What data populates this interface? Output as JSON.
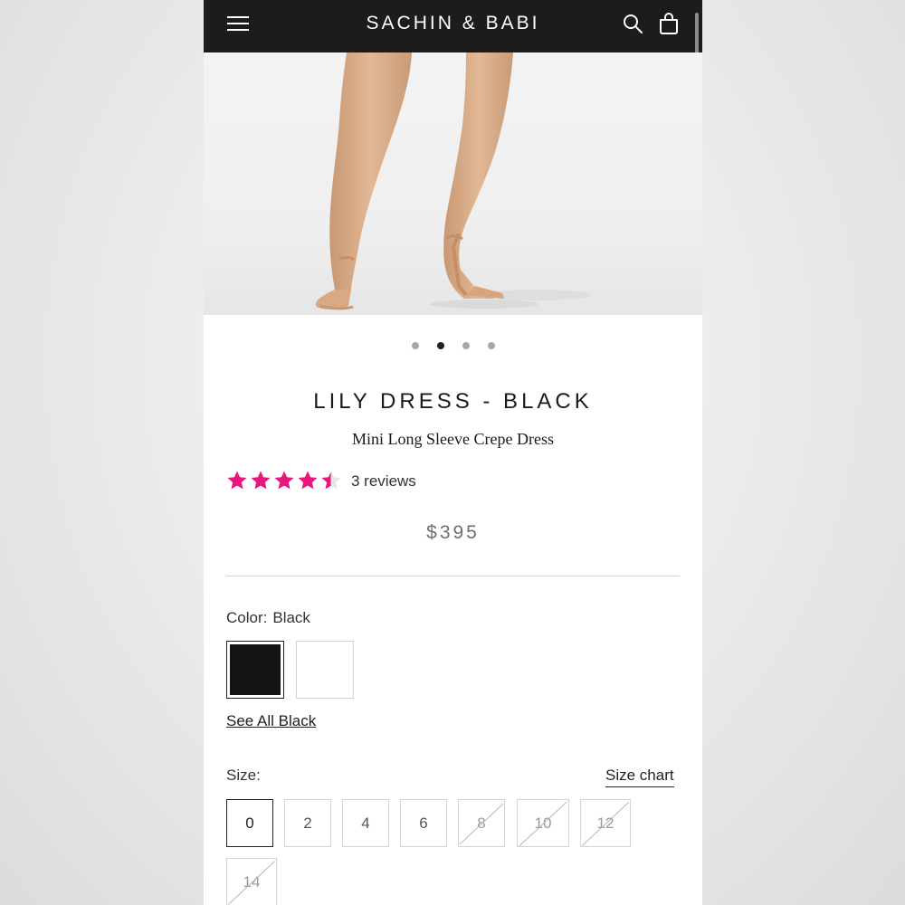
{
  "header": {
    "brand": "SACHIN & BABI",
    "icons": [
      "menu-icon",
      "search-icon",
      "bag-icon"
    ]
  },
  "gallery": {
    "dots_count": 4,
    "active_dot": 2
  },
  "product": {
    "title": "LILY DRESS - BLACK",
    "subtitle": "Mini Long Sleeve Crepe Dress",
    "rating": 4.5,
    "rating_max": 5,
    "reviews_text": "3 reviews",
    "price": "$395"
  },
  "color": {
    "label": "Color:",
    "selected": "Black",
    "swatches": [
      "#141414",
      "#ffffff"
    ],
    "see_all": "See All Black"
  },
  "size": {
    "label": "Size:",
    "chart_link": "Size chart",
    "options": [
      {
        "label": "0",
        "selected": true,
        "available": true
      },
      {
        "label": "2",
        "selected": false,
        "available": true
      },
      {
        "label": "4",
        "selected": false,
        "available": true
      },
      {
        "label": "6",
        "selected": false,
        "available": true
      },
      {
        "label": "8",
        "selected": false,
        "available": false
      },
      {
        "label": "10",
        "selected": false,
        "available": false
      },
      {
        "label": "12",
        "selected": false,
        "available": false
      },
      {
        "label": "14",
        "selected": false,
        "available": false
      }
    ]
  },
  "colors": {
    "header_bg": "#1c1c1c",
    "star": "#e8177e",
    "star_empty": "#e6e6e6"
  }
}
